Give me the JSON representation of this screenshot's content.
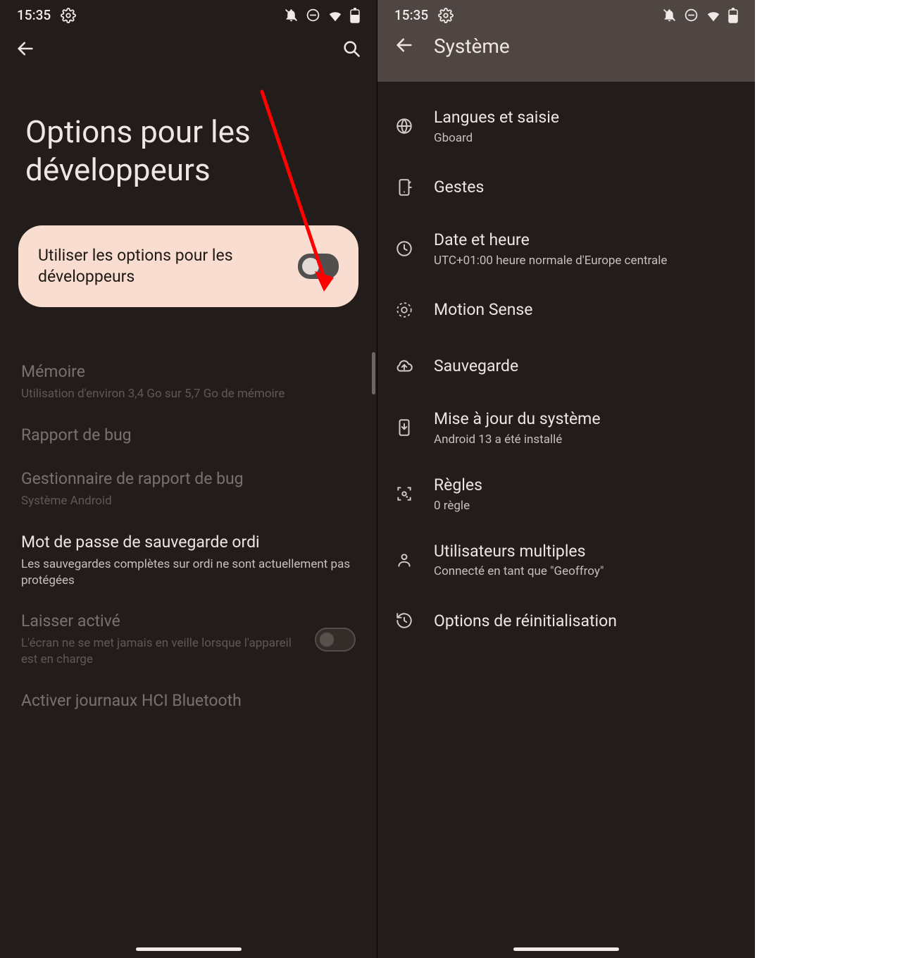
{
  "shared": {
    "status_time": "15:35"
  },
  "left": {
    "page_title": "Options pour les développeurs",
    "toggle_card_label": "Utiliser les options pour les développeurs",
    "toggle_on": false,
    "items": [
      {
        "title": "Mémoire",
        "subtitle": "Utilisation d'environ 3,4 Go sur 5,7 Go de mémoire",
        "faded": true
      },
      {
        "title": "Rapport de bug",
        "subtitle": "",
        "faded": true
      },
      {
        "title": "Gestionnaire de rapport de bug",
        "subtitle": "Système Android",
        "faded": true
      },
      {
        "title": "Mot de passe de sauvegarde ordi",
        "subtitle": "Les sauvegardes complètes sur ordi ne sont actuellement pas protégées",
        "faded": false
      },
      {
        "title": "Laisser activé",
        "subtitle": "L'écran ne se met jamais en veille lorsque l'appareil est en charge",
        "faded": true,
        "switch": true,
        "switch_on": false
      },
      {
        "title": "Activer journaux HCI Bluetooth",
        "subtitle": "",
        "faded": true
      }
    ]
  },
  "right": {
    "page_title": "Système",
    "items": [
      {
        "icon": "globe-icon",
        "title": "Langues et saisie",
        "subtitle": "Gboard"
      },
      {
        "icon": "gestures-icon",
        "title": "Gestes",
        "subtitle": ""
      },
      {
        "icon": "clock-icon",
        "title": "Date et heure",
        "subtitle": "UTC+01:00 heure normale d'Europe centrale"
      },
      {
        "icon": "motion-icon",
        "title": "Motion Sense",
        "subtitle": ""
      },
      {
        "icon": "cloud-up-icon",
        "title": "Sauvegarde",
        "subtitle": ""
      },
      {
        "icon": "update-icon",
        "title": "Mise à jour du système",
        "subtitle": "Android 13 a été installé"
      },
      {
        "icon": "rules-icon",
        "title": "Règles",
        "subtitle": "0 règle"
      },
      {
        "icon": "users-icon",
        "title": "Utilisateurs multiples",
        "subtitle": "Connecté en tant que \"Geoffroy\""
      },
      {
        "icon": "reset-icon",
        "title": "Options de réinitialisation",
        "subtitle": ""
      }
    ]
  }
}
